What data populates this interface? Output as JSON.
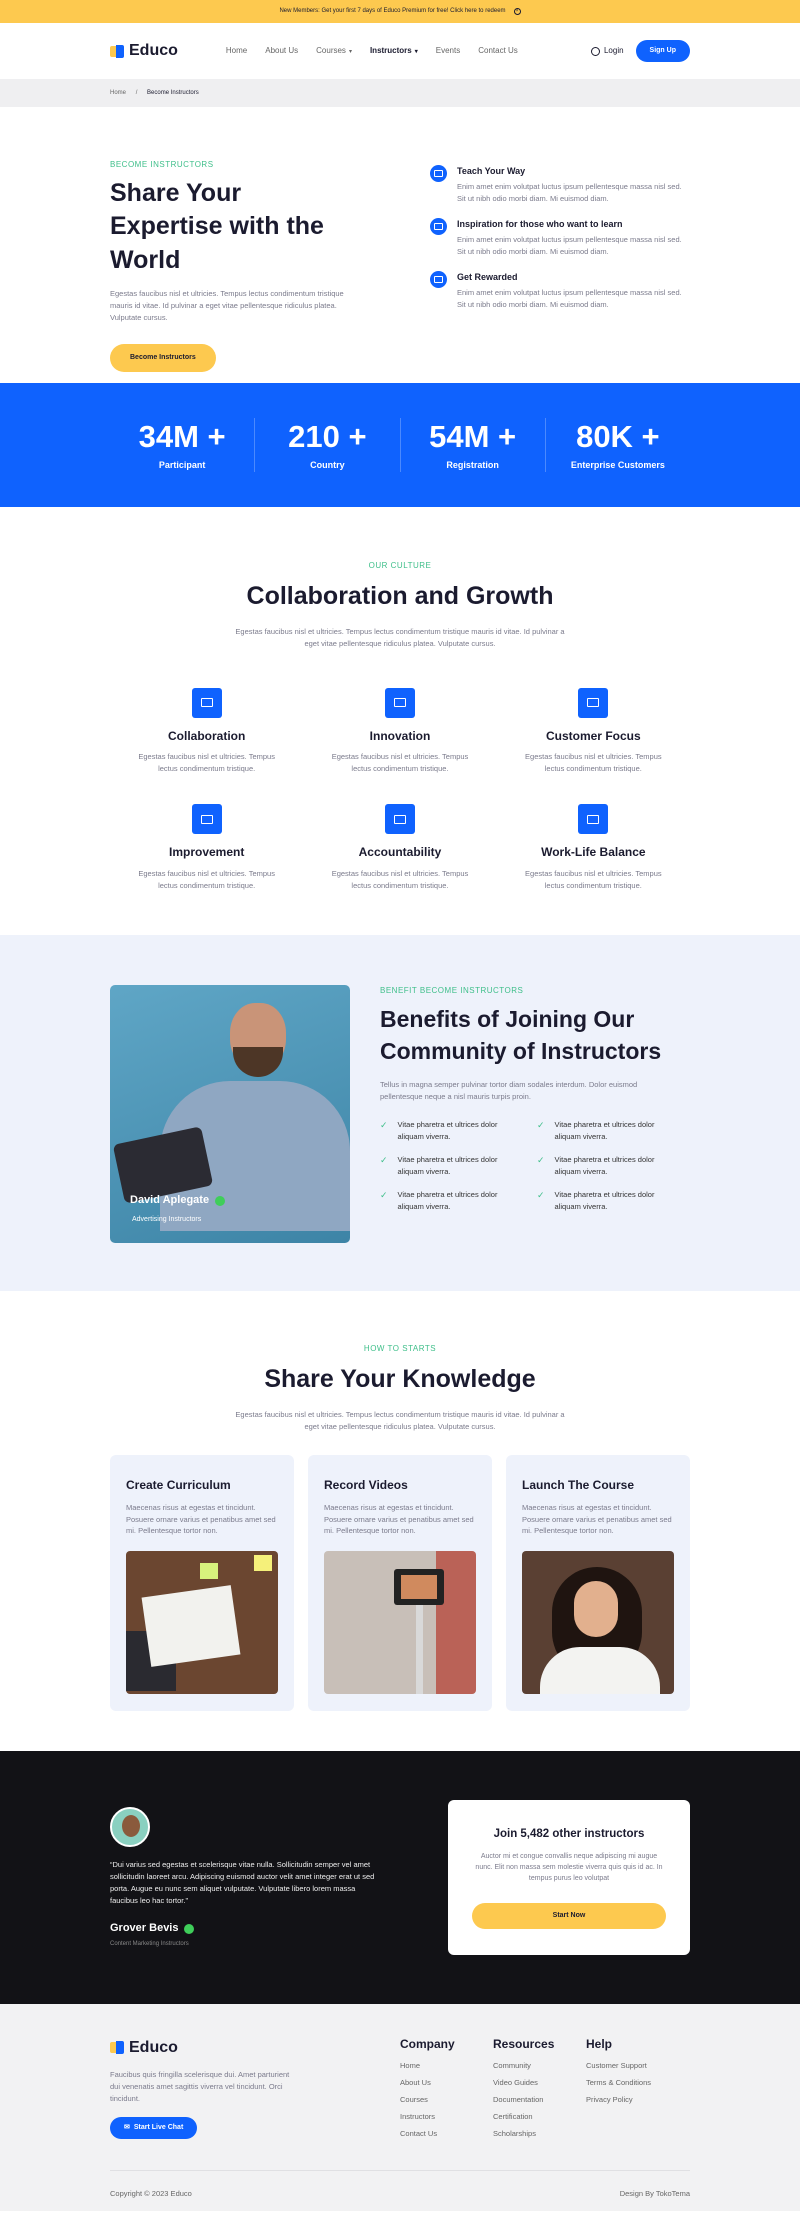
{
  "topbar": {
    "text": "New Members: Get your first 7 days of Educo Premium for free! Click here to redeem",
    "close_icon": "close-icon"
  },
  "header": {
    "brand": "Educo",
    "nav": [
      {
        "label": "Home"
      },
      {
        "label": "About Us"
      },
      {
        "label": "Courses"
      },
      {
        "label": "Instructors"
      },
      {
        "label": "Events"
      },
      {
        "label": "Contact Us"
      }
    ],
    "login": "Login",
    "signup": "Sign Up"
  },
  "breadcrumb": {
    "home": "Home",
    "sep": "/",
    "current": "Become Instructors"
  },
  "hero": {
    "eyebrow": "BECOME INSTRUCTORS",
    "title": "Share Your Expertise with the World",
    "desc": "Egestas faucibus nisl et ultricies. Tempus lectus condimentum tristique mauris id vitae. Id pulvinar a eget vitae pellentesque ridiculus platea. Vulputate cursus.",
    "cta": "Become Instructors",
    "features": [
      {
        "title": "Teach Your Way",
        "desc": "Enim amet enim volutpat luctus ipsum pellentesque massa nisl sed. Sit ut nibh odio morbi diam. Mi euismod diam."
      },
      {
        "title": "Inspiration for those who want to learn",
        "desc": "Enim amet enim volutpat luctus ipsum pellentesque massa nisl sed. Sit ut nibh odio morbi diam. Mi euismod diam."
      },
      {
        "title": "Get Rewarded",
        "desc": "Enim amet enim volutpat luctus ipsum pellentesque massa nisl sed. Sit ut nibh odio morbi diam. Mi euismod diam."
      }
    ]
  },
  "stats": [
    {
      "value": "34M +",
      "label": "Participant"
    },
    {
      "value": "210 +",
      "label": "Country"
    },
    {
      "value": "54M +",
      "label": "Registration"
    },
    {
      "value": "80K +",
      "label": "Enterprise Customers"
    }
  ],
  "culture": {
    "eyebrow": "OUR CULTURE",
    "title": "Collaboration and Growth",
    "desc": "Egestas faucibus nisl et ultricies. Tempus lectus condimentum tristique mauris id vitae. Id pulvinar a eget vitae pellentesque ridiculus platea. Vulputate cursus.",
    "items": [
      {
        "title": "Collaboration",
        "desc": "Egestas faucibus nisl et ultricies. Tempus lectus condimentum tristique."
      },
      {
        "title": "Innovation",
        "desc": "Egestas faucibus nisl et ultricies. Tempus lectus condimentum tristique."
      },
      {
        "title": "Customer Focus",
        "desc": "Egestas faucibus nisl et ultricies. Tempus lectus condimentum tristique."
      },
      {
        "title": "Improvement",
        "desc": "Egestas faucibus nisl et ultricies. Tempus lectus condimentum tristique."
      },
      {
        "title": "Accountability",
        "desc": "Egestas faucibus nisl et ultricies. Tempus lectus condimentum tristique."
      },
      {
        "title": "Work-Life Balance",
        "desc": "Egestas faucibus nisl et ultricies. Tempus lectus condimentum tristique."
      }
    ]
  },
  "benefits": {
    "eyebrow": "BENEFIT BECOME INSTRUCTORS",
    "title": "Benefits of Joining Our Community of Instructors",
    "desc": "Tellus in magna semper pulvinar tortor diam sodales interdum. Dolor euismod pellentesque neque a nisl mauris turpis proin.",
    "person_name": "David Aplegate",
    "person_role": "Advertising Instructors",
    "checks": [
      "Vitae pharetra et ultrices dolor aliquam viverra.",
      "Vitae pharetra et ultrices dolor aliquam viverra.",
      "Vitae pharetra et ultrices dolor aliquam viverra.",
      "Vitae pharetra et ultrices dolor aliquam viverra.",
      "Vitae pharetra et ultrices dolor aliquam viverra.",
      "Vitae pharetra et ultrices dolor aliquam viverra."
    ]
  },
  "how": {
    "eyebrow": "HOW TO STARTS",
    "title": "Share Your Knowledge",
    "desc": "Egestas faucibus nisl et ultricies. Tempus lectus condimentum tristique mauris id vitae. Id pulvinar a eget vitae pellentesque ridiculus platea. Vulputate cursus.",
    "steps": [
      {
        "title": "Create Curriculum",
        "desc": "Maecenas risus at egestas et tincidunt. Posuere ornare varius et penatibus amet sed mi. Pellentesque tortor non."
      },
      {
        "title": "Record Videos",
        "desc": "Maecenas risus at egestas et tincidunt. Posuere ornare varius et penatibus amet sed mi. Pellentesque tortor non."
      },
      {
        "title": "Launch The Course",
        "desc": "Maecenas risus at egestas et tincidunt. Posuere ornare varius et penatibus amet sed mi. Pellentesque tortor non."
      }
    ]
  },
  "testimonial": {
    "quote": "“Dui varius sed egestas et scelerisque vitae nulla. Sollicitudin semper vel amet sollicitudin laoreet arcu. Adipiscing euismod auctor velit amet integer erat ut sed porta. Augue eu nunc sem aliquet vulputate. Vulputate libero lorem massa faucibus leo hac tortor.”",
    "name": "Grover Bevis",
    "role": "Content Marketing Instructors"
  },
  "join": {
    "title": "Join 5,482 other instructors",
    "desc": "Auctor mi et congue convallis neque adipiscing mi augue nunc. Elit non massa sem molestie viverra quis quis id ac. In tempus purus leo volutpat",
    "cta": "Start Now"
  },
  "footer": {
    "brand": "Educo",
    "desc": "Faucibus quis fringilla scelerisque dui. Amet parturient dui venenatis amet sagittis viverra vel tincidunt. Orci tincidunt.",
    "chat": "Start Live Chat",
    "cols": [
      {
        "title": "Company",
        "links": [
          "Home",
          "About Us",
          "Courses",
          "Instructors",
          "Contact Us"
        ]
      },
      {
        "title": "Resources",
        "links": [
          "Community",
          "Video Guides",
          "Documentation",
          "Certification",
          "Scholarships"
        ]
      },
      {
        "title": "Help",
        "links": [
          "Customer Support",
          "Terms & Conditions",
          "Privacy Policy"
        ]
      }
    ],
    "copyright": "Copyright © 2023 Educo",
    "credit": "Design By TokoTema"
  },
  "colors": {
    "primary": "#0f62fe",
    "accent": "#fdc94f",
    "green": "#3fbf8a",
    "dark": "#121216"
  }
}
